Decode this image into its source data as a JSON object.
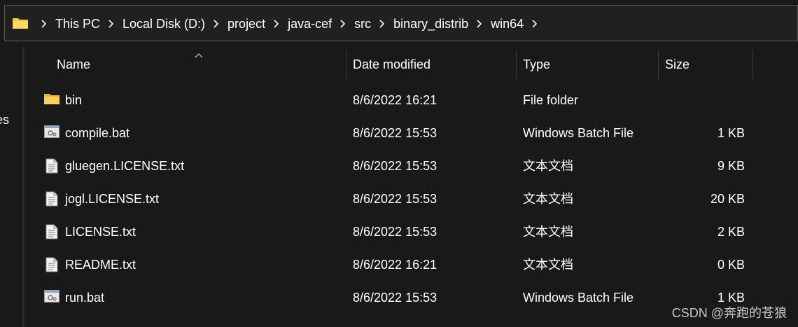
{
  "address_bar": {
    "icon": "folder-icon",
    "breadcrumbs": [
      "This PC",
      "Local Disk (D:)",
      "project",
      "java-cef",
      "src",
      "binary_distrib",
      "win64"
    ],
    "separator_icon": "chevron-right-icon",
    "trailing_icon": "chevron-right-icon"
  },
  "sidebar": {
    "partial_label": "iles"
  },
  "columns": {
    "name": "Name",
    "date": "Date modified",
    "type": "Type",
    "size": "Size",
    "sort_icon": "sort-ascending-icon"
  },
  "files": [
    {
      "name": "bin",
      "date": "8/6/2022 16:21",
      "type": "File folder",
      "size": "",
      "icon": "folder-icon"
    },
    {
      "name": "compile.bat",
      "date": "8/6/2022 15:53",
      "type": "Windows Batch File",
      "size": "1 KB",
      "icon": "batch-file-icon"
    },
    {
      "name": "gluegen.LICENSE.txt",
      "date": "8/6/2022 15:53",
      "type": "文本文档",
      "size": "9 KB",
      "icon": "text-file-icon"
    },
    {
      "name": "jogl.LICENSE.txt",
      "date": "8/6/2022 15:53",
      "type": "文本文档",
      "size": "20 KB",
      "icon": "text-file-icon"
    },
    {
      "name": "LICENSE.txt",
      "date": "8/6/2022 15:53",
      "type": "文本文档",
      "size": "2 KB",
      "icon": "text-file-icon"
    },
    {
      "name": "README.txt",
      "date": "8/6/2022 16:21",
      "type": "文本文档",
      "size": "0 KB",
      "icon": "text-file-icon"
    },
    {
      "name": "run.bat",
      "date": "8/6/2022 15:53",
      "type": "Windows Batch File",
      "size": "1 KB",
      "icon": "batch-file-icon"
    }
  ],
  "watermark": "CSDN @奔跑的苍狼",
  "colors": {
    "background": "#191919",
    "folder": "#f5c542",
    "text": "#ffffff"
  }
}
